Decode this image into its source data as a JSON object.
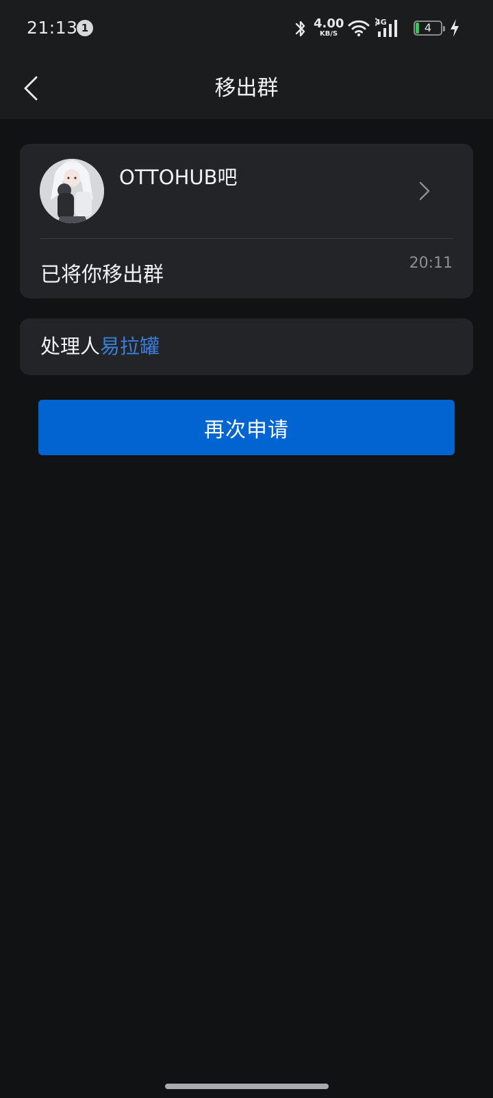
{
  "status_bar": {
    "time": "21:13",
    "notification_count": "1",
    "net_speed_value": "4.00",
    "net_speed_unit": "KB/S",
    "network_type": "4G",
    "battery_level": "4",
    "icons": [
      "bluetooth-icon",
      "wifi-icon",
      "signal-icon",
      "battery-icon",
      "charging-icon"
    ]
  },
  "nav": {
    "title": "移出群",
    "back_icon": "back-arrow-icon"
  },
  "group": {
    "name": "OTTOHUB吧",
    "avatar": "group-avatar",
    "chevron_icon": "chevron-right-icon",
    "message": "已将你移出群",
    "time": "20:11"
  },
  "handler": {
    "label": "处理人",
    "name": "易拉罐"
  },
  "actions": {
    "reapply_label": "再次申请"
  },
  "colors": {
    "background": "#111214",
    "card": "#232427",
    "bar": "#1b1c1e",
    "accent_button": "#0064d1",
    "link": "#3a7edb",
    "battery_fill": "#35c759"
  }
}
